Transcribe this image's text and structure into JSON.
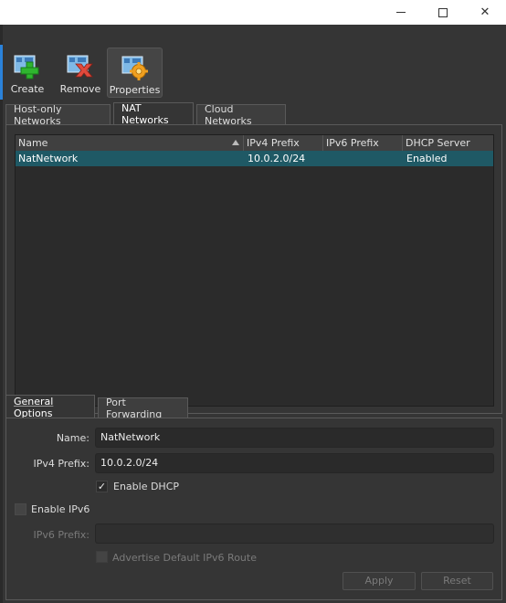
{
  "window": {
    "minimize_glyph": "—",
    "maximize_glyph": "☐",
    "close_glyph": "✕"
  },
  "toolbar": {
    "create_label": "Create",
    "remove_label": "Remove",
    "properties_label": "Properties"
  },
  "tabs": {
    "host_only": "Host-only Networks",
    "nat": "NAT Networks",
    "cloud": "Cloud Networks"
  },
  "table": {
    "columns": [
      "Name",
      "IPv4 Prefix",
      "IPv6 Prefix",
      "DHCP Server"
    ],
    "rows": [
      {
        "name": "NatNetwork",
        "ipv4": "10.0.2.0/24",
        "ipv6": "",
        "dhcp": "Enabled"
      }
    ]
  },
  "subtabs": {
    "general": "General Options",
    "port_forwarding": "Port Forwarding"
  },
  "form": {
    "name_label": "Name:",
    "name_value": "NatNetwork",
    "ipv4_label": "IPv4 Prefix:",
    "ipv4_value": "10.0.2.0/24",
    "enable_dhcp": "Enable DHCP",
    "enable_dhcp_checked": true,
    "enable_ipv6": "Enable IPv6",
    "enable_ipv6_checked": false,
    "ipv6_label": "IPv6 Prefix:",
    "ipv6_value": "",
    "advertise": "Advertise Default IPv6 Route",
    "advertise_checked": false,
    "apply": "Apply",
    "reset": "Reset"
  },
  "colors": {
    "background": "#353535",
    "selection": "#1f5965",
    "accent": "#2a82da"
  }
}
